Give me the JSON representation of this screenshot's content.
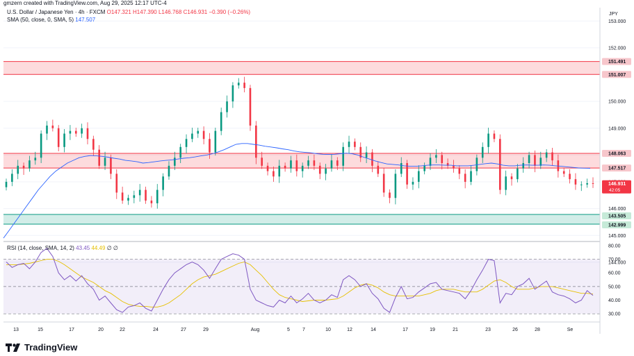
{
  "header": {
    "created_by": "gmzern created with TradingView.com, Aug 29, 2025 12:17 UTC-4",
    "symbol": "U.S. Dollar / Japanese Yen · 4h · FXCM",
    "open": "O147.321",
    "high": "H147.390",
    "low": "L146.768",
    "close": "C146.931",
    "change": "−0.390 (−0.26%)",
    "sma_label": "SMA (50, close, 0, SMA, 5)",
    "sma_value": "147.507",
    "rsi_label": "RSI (14, close, SMA, 14, 2)",
    "rsi_value": "43.45",
    "rsi_ma_value": "44.49",
    "rsi_extra": "∅ ∅"
  },
  "brand": "TradingView",
  "colors": {
    "up": "#089981",
    "down": "#f23645",
    "sma": "#2962ff",
    "rsi": "#7e57c2",
    "rsi_ma": "#e6c000",
    "resistance_zone": "#f23645",
    "support_zone": "#089981"
  },
  "chart_data": {
    "type": "candlestick",
    "symbol": "USDJPY",
    "timeframe": "4h",
    "currency": "JPY",
    "ylim": [
      144.8,
      153.5
    ],
    "price_ticks": [
      "153.000",
      "152.000",
      "151.000",
      "150.000",
      "149.000",
      "148.000",
      "147.000",
      "146.000",
      "145.000",
      "144.000"
    ],
    "x_labels": [
      "13",
      "15",
      "17",
      "20",
      "22",
      "24",
      "27",
      "29",
      "Aug",
      "5",
      "7",
      "10",
      "12",
      "14",
      "17",
      "19",
      "21",
      "23",
      "26",
      "28",
      "Se"
    ],
    "zones": [
      {
        "kind": "resistance",
        "from": 151.007,
        "to": 151.491
      },
      {
        "kind": "resistance",
        "from": 147.517,
        "to": 148.063
      },
      {
        "kind": "support",
        "from": 142.999,
        "to": 143.505
      }
    ],
    "price_labels": [
      {
        "value": 151.491,
        "text": "151.491",
        "kind": "zone-red"
      },
      {
        "value": 151.007,
        "text": "151.007",
        "kind": "zone-red"
      },
      {
        "value": 148.063,
        "text": "148.063",
        "kind": "zone-red"
      },
      {
        "value": 147.517,
        "text": "147.517",
        "kind": "zone-red"
      },
      {
        "value": 146.931,
        "text": "146.931",
        "kind": "last",
        "countdown": "42:05"
      },
      {
        "value": 143.505,
        "text": "143.505",
        "kind": "zone-green"
      },
      {
        "value": 142.999,
        "text": "142.999",
        "kind": "zone-green"
      }
    ],
    "close": [
      147.0,
      147.3,
      147.6,
      147.5,
      147.8,
      147.9,
      148.8,
      149.1,
      149.0,
      148.3,
      148.8,
      148.9,
      148.8,
      149.0,
      148.6,
      148.2,
      147.6,
      147.9,
      147.3,
      146.6,
      146.3,
      146.4,
      146.5,
      146.7,
      146.3,
      146.2,
      146.7,
      147.2,
      147.6,
      147.9,
      148.3,
      148.6,
      148.8,
      148.9,
      148.6,
      148.1,
      148.9,
      149.6,
      150.0,
      150.6,
      150.7,
      150.5,
      149.1,
      147.9,
      147.6,
      147.4,
      147.2,
      147.6,
      147.5,
      147.8,
      147.4,
      147.6,
      147.8,
      147.6,
      147.3,
      147.5,
      147.8,
      147.6,
      148.3,
      148.5,
      148.3,
      147.9,
      148.1,
      147.6,
      147.3,
      146.6,
      146.4,
      147.3,
      147.7,
      146.9,
      147.0,
      147.4,
      147.6,
      147.9,
      148.0,
      147.7,
      147.6,
      147.5,
      147.3,
      147.0,
      147.4,
      147.9,
      148.3,
      148.8,
      148.6,
      146.7,
      147.2,
      147.1,
      147.5,
      147.7,
      148.0,
      147.6,
      147.9,
      148.1,
      147.8,
      147.4,
      147.3,
      147.1,
      146.9,
      146.9,
      146.95,
      146.93
    ],
    "sma": [
      144.9,
      145.2,
      145.5,
      145.8,
      146.1,
      146.4,
      146.7,
      146.95,
      147.2,
      147.4,
      147.55,
      147.7,
      147.8,
      147.9,
      147.95,
      147.98,
      147.97,
      147.95,
      147.92,
      147.88,
      147.85,
      147.8,
      147.78,
      147.75,
      147.7,
      147.72,
      147.75,
      147.78,
      147.8,
      147.82,
      147.85,
      147.88,
      147.9,
      147.93,
      147.97,
      148.0,
      148.05,
      148.12,
      148.2,
      148.3,
      148.4,
      148.43,
      148.43,
      148.4,
      148.37,
      148.33,
      148.3,
      148.27,
      148.23,
      148.2,
      148.15,
      148.12,
      148.1,
      148.08,
      148.05,
      148.03,
      148.02,
      148.03,
      148.05,
      148.07,
      148.05,
      148.0,
      147.92,
      147.85,
      147.78,
      147.72,
      147.67,
      147.65,
      147.63,
      147.6,
      147.58,
      147.58,
      147.6,
      147.62,
      147.63,
      147.63,
      147.62,
      147.62,
      147.6,
      147.6,
      147.6,
      147.62,
      147.65,
      147.68,
      147.7,
      147.67,
      147.62,
      147.6,
      147.6,
      147.62,
      147.63,
      147.62,
      147.62,
      147.63,
      147.62,
      147.6,
      147.58,
      147.56,
      147.54,
      147.52,
      147.51,
      147.507
    ],
    "rsi": [
      68,
      64,
      66,
      67,
      63,
      68,
      75,
      78,
      72,
      60,
      55,
      58,
      54,
      58,
      52,
      48,
      40,
      43,
      38,
      33,
      31,
      35,
      36,
      38,
      34,
      32,
      40,
      48,
      55,
      60,
      63,
      66,
      68,
      66,
      62,
      56,
      63,
      70,
      72,
      74,
      73,
      70,
      48,
      40,
      38,
      36,
      35,
      40,
      38,
      43,
      38,
      41,
      45,
      40,
      38,
      40,
      44,
      42,
      55,
      58,
      55,
      50,
      52,
      45,
      41,
      34,
      31,
      42,
      50,
      41,
      42,
      46,
      49,
      52,
      53,
      48,
      47,
      46,
      45,
      41,
      47,
      55,
      62,
      70,
      69,
      38,
      45,
      44,
      50,
      52,
      56,
      48,
      51,
      54,
      46,
      44,
      43,
      41,
      38,
      40,
      47,
      43.45
    ],
    "rsi_ma": [
      66,
      66,
      66,
      66.5,
      67,
      68,
      69,
      70,
      70,
      68.5,
      66,
      63,
      60,
      57,
      55,
      53,
      50,
      47,
      45,
      42,
      39,
      37,
      36,
      35.5,
      35.5,
      35,
      35,
      36,
      38,
      41,
      44,
      48,
      52,
      55,
      57,
      58,
      59,
      61,
      63,
      65,
      67,
      68,
      66,
      62,
      58,
      53,
      48,
      44,
      42,
      41,
      40,
      39,
      39.5,
      40,
      40,
      40,
      40.5,
      41,
      43,
      46,
      49,
      51,
      52,
      51,
      49,
      46,
      44,
      43,
      43,
      43,
      43,
      43,
      44,
      45,
      47,
      48,
      48,
      48,
      47,
      46,
      46,
      46,
      48,
      51,
      54,
      55,
      53,
      50,
      48,
      48,
      48,
      49,
      50,
      50,
      50,
      49,
      48,
      47,
      46,
      45,
      45,
      44.49
    ],
    "rsi_levels": [
      70,
      50,
      30
    ],
    "rsi_ticks": [
      "80.00",
      "70.00",
      "60.00",
      "50.00",
      "40.00",
      "30.00"
    ],
    "rsi_ylim": [
      25,
      82
    ]
  }
}
